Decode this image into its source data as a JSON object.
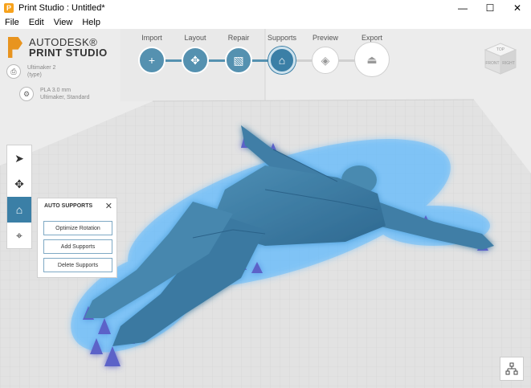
{
  "window": {
    "title": "Print Studio : Untitled*",
    "app_icon": "P",
    "minimize": "—",
    "maximize": "☐",
    "close": "✕"
  },
  "menu": {
    "items": [
      "File",
      "Edit",
      "View",
      "Help"
    ]
  },
  "logo": {
    "line1": "AUTODESK®",
    "line2": "PRINT STUDIO"
  },
  "printer": {
    "name": "Ultimaker 2",
    "type": "(type)",
    "icon": "printer-icon"
  },
  "material": {
    "name": "PLA 3.0 mm",
    "profile": "Ultimaker, Standard",
    "icon": "gear-icon"
  },
  "workflow": {
    "steps": [
      {
        "label": "Import",
        "glyph": "+",
        "state": "done"
      },
      {
        "label": "Layout",
        "glyph": "✥",
        "state": "done"
      },
      {
        "label": "Repair",
        "glyph": "▧",
        "state": "done"
      },
      {
        "label": "Supports",
        "glyph": "⌂",
        "state": "active"
      },
      {
        "label": "Preview",
        "glyph": "◈",
        "state": "pending"
      },
      {
        "label": "Export",
        "glyph": "⏏",
        "state": "pending"
      }
    ]
  },
  "viewcube": {
    "top": "TOP",
    "front": "FRONT",
    "right": "RIGHT"
  },
  "tools": [
    {
      "name": "select-tool",
      "glyph": "➤",
      "active": false
    },
    {
      "name": "move-tool",
      "glyph": "✥",
      "active": false
    },
    {
      "name": "supports-tool",
      "glyph": "⌂",
      "active": true
    },
    {
      "name": "support-edit-tool",
      "glyph": "⌖",
      "active": false
    }
  ],
  "panel": {
    "title": "AUTO SUPPORTS",
    "close": "✕",
    "buttons": [
      "Optimize Rotation",
      "Add Supports",
      "Delete Supports"
    ]
  },
  "colors": {
    "accent": "#3b7fa6",
    "model": "#3f7ea6",
    "support": "#5b62c8",
    "glow": "#56b6ff"
  }
}
